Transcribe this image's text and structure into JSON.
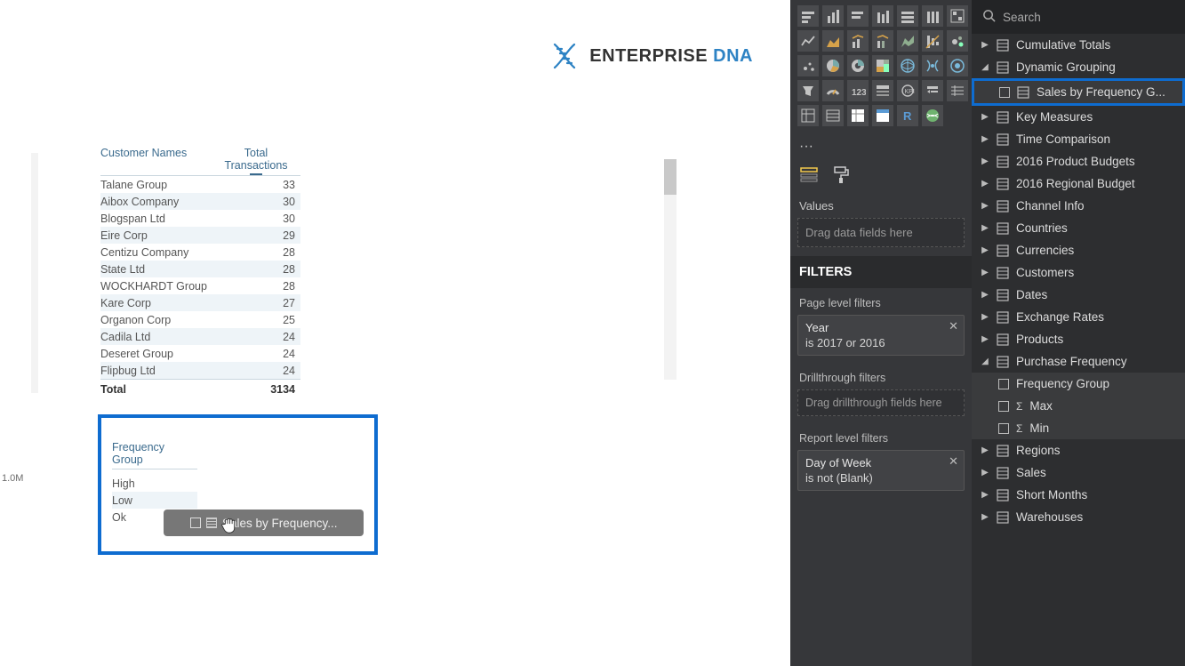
{
  "logo": {
    "brand": "ENTERPRISE",
    "accent": "DNA"
  },
  "canvas": {
    "axis_label": "1.0M",
    "table": {
      "columns": {
        "name": "Customer Names",
        "total": "Total Transactions"
      },
      "rows": [
        {
          "name": "Talane Group",
          "value": "33"
        },
        {
          "name": "Aibox Company",
          "value": "30"
        },
        {
          "name": "Blogspan Ltd",
          "value": "30"
        },
        {
          "name": "Eire Corp",
          "value": "29"
        },
        {
          "name": "Centizu Company",
          "value": "28"
        },
        {
          "name": "State Ltd",
          "value": "28"
        },
        {
          "name": "WOCKHARDT Group",
          "value": "28"
        },
        {
          "name": "Kare Corp",
          "value": "27"
        },
        {
          "name": "Organon Corp",
          "value": "25"
        },
        {
          "name": "Cadila Ltd",
          "value": "24"
        },
        {
          "name": "Deseret Group",
          "value": "24"
        },
        {
          "name": "Flipbug Ltd",
          "value": "24"
        }
      ],
      "total_label": "Total",
      "total_value": "3134"
    },
    "frequency": {
      "header": "Frequency Group",
      "rows": [
        "High",
        "Low",
        "Ok"
      ]
    },
    "drag_chip": "Sales by Frequency..."
  },
  "viz_panel": {
    "more": "···",
    "values_label": "Values",
    "values_placeholder": "Drag data fields here",
    "filters_title": "FILTERS",
    "page_filters_label": "Page level filters",
    "year_filter": {
      "title": "Year",
      "desc": "is 2017 or 2016"
    },
    "drill_label": "Drillthrough filters",
    "drill_placeholder": "Drag drillthrough fields here",
    "report_filters_label": "Report level filters",
    "dow_filter": {
      "title": "Day of Week",
      "desc": "is not (Blank)"
    }
  },
  "fields": {
    "search_placeholder": "Search",
    "items": [
      {
        "caret": "▶",
        "label": "Cumulative Totals"
      },
      {
        "caret": "◢",
        "label": "Dynamic Grouping"
      },
      {
        "caret": "",
        "label": "Sales by Frequency G...",
        "child": true,
        "highlight": true
      },
      {
        "caret": "▶",
        "label": "Key Measures"
      },
      {
        "caret": "▶",
        "label": "Time Comparison"
      },
      {
        "caret": "▶",
        "label": "2016 Product Budgets"
      },
      {
        "caret": "▶",
        "label": "2016 Regional Budget"
      },
      {
        "caret": "▶",
        "label": "Channel Info"
      },
      {
        "caret": "▶",
        "label": "Countries"
      },
      {
        "caret": "▶",
        "label": "Currencies"
      },
      {
        "caret": "▶",
        "label": "Customers"
      },
      {
        "caret": "▶",
        "label": "Dates"
      },
      {
        "caret": "▶",
        "label": "Exchange Rates"
      },
      {
        "caret": "▶",
        "label": "Products"
      },
      {
        "caret": "◢",
        "label": "Purchase Frequency"
      },
      {
        "caret": "",
        "label": "Frequency Group",
        "child2": true
      },
      {
        "caret": "",
        "label": "Max",
        "child2": true,
        "sigma": true
      },
      {
        "caret": "",
        "label": "Min",
        "child2": true,
        "sigma": true
      },
      {
        "caret": "▶",
        "label": "Regions"
      },
      {
        "caret": "▶",
        "label": "Sales"
      },
      {
        "caret": "▶",
        "label": "Short Months"
      },
      {
        "caret": "▶",
        "label": "Warehouses"
      }
    ]
  }
}
